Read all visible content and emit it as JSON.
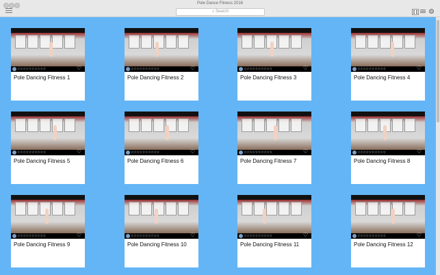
{
  "window": {
    "title": "Pole Dance Fitness 2016"
  },
  "toolbar": {
    "search_placeholder": "Search",
    "menu_icon": "hamburger-icon",
    "grid_icon": "grid-view-icon",
    "list_icon": "list-view-icon",
    "gear_icon": "gear-icon"
  },
  "rating_icon": "☆☆☆☆☆☆☆☆☆☆",
  "favorite_icon": "♡",
  "videos": [
    {
      "title": "Pole Dancing Fitness 1"
    },
    {
      "title": "Pole Dancing Fitness 2"
    },
    {
      "title": "Pole Dancing Fitness 3"
    },
    {
      "title": "Pole Dancing Fitness 4"
    },
    {
      "title": "Pole Dancing Fitness 5"
    },
    {
      "title": "Pole Dancing Fitness 6"
    },
    {
      "title": "Pole Dancing Fitness 7"
    },
    {
      "title": "Pole Dancing Fitness 8"
    },
    {
      "title": "Pole Dancing Fitness 9"
    },
    {
      "title": "Pole Dancing Fitness 10"
    },
    {
      "title": "Pole Dancing Fitness 11"
    },
    {
      "title": "Pole Dancing Fitness 12"
    }
  ],
  "colors": {
    "background": "#64b5f6",
    "card": "#ffffff"
  }
}
